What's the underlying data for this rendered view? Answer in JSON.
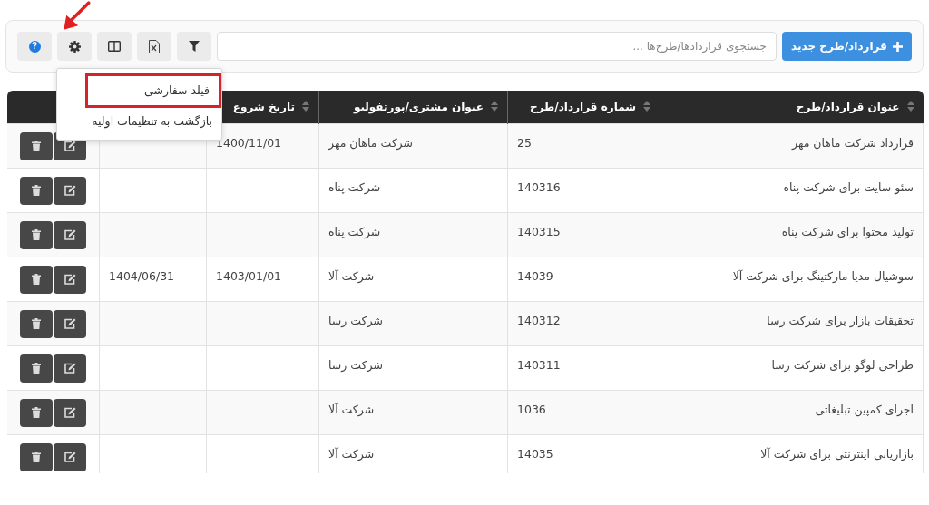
{
  "toolbar": {
    "new_button": {
      "label": "قرارداد/طرح جدید"
    },
    "search": {
      "placeholder": "جستجوی قراردادها/طرح‌ها ..."
    },
    "tool_buttons": [
      {
        "kind": "filter"
      },
      {
        "kind": "excel"
      },
      {
        "kind": "columns"
      },
      {
        "kind": "settings"
      },
      {
        "kind": "help",
        "glyph": "?"
      }
    ]
  },
  "settings_menu": {
    "items": [
      {
        "label": "فیلد سفارشی",
        "annotated": true
      },
      {
        "label": "بازگشت به تنظیمات اولیه",
        "annotated": false
      }
    ]
  },
  "table": {
    "columns": [
      {
        "label": "عنوان قرارداد/طرح",
        "sortable": true
      },
      {
        "label": "شماره قرارداد/طرح",
        "sortable": true
      },
      {
        "label": "عنوان مشتری/پورتفولیو",
        "sortable": true
      },
      {
        "label": "تاریخ شروع",
        "sortable": true
      }
    ],
    "rows": [
      {
        "title": "قرارداد شرکت ماهان مهر",
        "number": "25",
        "customer": "شرکت ماهان مهر",
        "start_date": "1400/11/01"
      },
      {
        "title": "سئو سایت برای شرکت پناه",
        "number": "140316",
        "customer": "شرکت پناه"
      },
      {
        "title": "تولید محتوا برای شرکت پناه",
        "number": "140315",
        "customer": "شرکت پناه"
      },
      {
        "title": "سوشیال مدیا مارکتینگ برای شرکت آلا",
        "number": "14039",
        "customer": "شرکت آلا",
        "start_date": "1403/01/01",
        "column_5": "1404/06/31"
      },
      {
        "title": "تحقیقات بازار برای شرکت رسا",
        "number": "140312",
        "customer": "شرکت رسا"
      },
      {
        "title": "طراحی لوگو برای شرکت رسا",
        "number": "140311",
        "customer": "شرکت رسا"
      },
      {
        "title": "اجرای کمپین تبلیغاتی",
        "number": "1036",
        "customer": "شرکت آلا"
      },
      {
        "title": "بازاریابی اینترنتی برای شرکت آلا",
        "number": "14035",
        "customer": "شرکت آلا"
      }
    ]
  }
}
